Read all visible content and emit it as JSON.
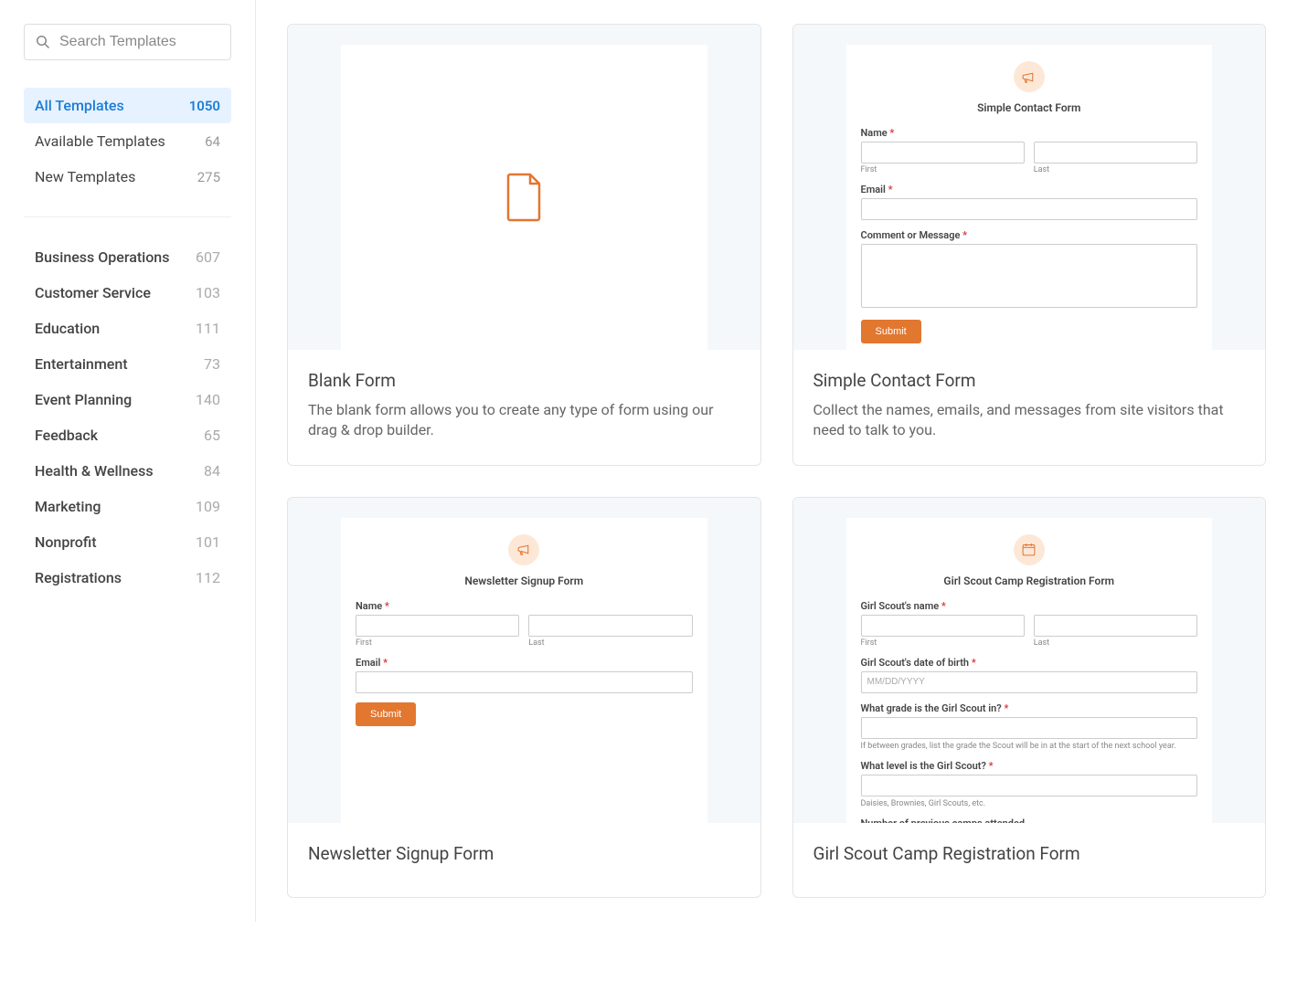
{
  "sidebar": {
    "search_placeholder": "Search Templates",
    "filters": [
      {
        "label": "All Templates",
        "count": "1050",
        "active": true
      },
      {
        "label": "Available Templates",
        "count": "64",
        "active": false
      },
      {
        "label": "New Templates",
        "count": "275",
        "active": false
      }
    ],
    "categories": [
      {
        "label": "Business Operations",
        "count": "607"
      },
      {
        "label": "Customer Service",
        "count": "103"
      },
      {
        "label": "Education",
        "count": "111"
      },
      {
        "label": "Entertainment",
        "count": "73"
      },
      {
        "label": "Event Planning",
        "count": "140"
      },
      {
        "label": "Feedback",
        "count": "65"
      },
      {
        "label": "Health & Wellness",
        "count": "84"
      },
      {
        "label": "Marketing",
        "count": "109"
      },
      {
        "label": "Nonprofit",
        "count": "101"
      },
      {
        "label": "Registrations",
        "count": "112"
      }
    ]
  },
  "templates": [
    {
      "title": "Blank Form",
      "desc": "The blank form allows you to create any type of form using our drag & drop builder."
    },
    {
      "title": "Simple Contact Form",
      "desc": "Collect the names, emails, and messages from site visitors that need to talk to you."
    },
    {
      "title": "Newsletter Signup Form",
      "desc": ""
    },
    {
      "title": "Girl Scout Camp Registration Form",
      "desc": ""
    }
  ],
  "preview": {
    "simple_contact": {
      "title": "Simple Contact Form",
      "name_label": "Name",
      "first": "First",
      "last": "Last",
      "email_label": "Email",
      "comment_label": "Comment or Message",
      "submit": "Submit"
    },
    "newsletter": {
      "title": "Newsletter Signup Form",
      "name_label": "Name",
      "first": "First",
      "last": "Last",
      "email_label": "Email",
      "submit": "Submit"
    },
    "girlscout": {
      "title": "Girl Scout Camp Registration Form",
      "name_label": "Girl Scout's name",
      "first": "First",
      "last": "Last",
      "dob_label": "Girl Scout's date of birth",
      "dob_placeholder": "MM/DD/YYYY",
      "grade_label": "What grade is the Girl Scout in?",
      "grade_help": "If between grades, list the grade the Scout will be in at the start of the next school year.",
      "level_label": "What level is the Girl Scout?",
      "level_help": "Daisies, Brownies, Girl Scouts, etc.",
      "camps_label": "Number of previous camps attended"
    }
  }
}
